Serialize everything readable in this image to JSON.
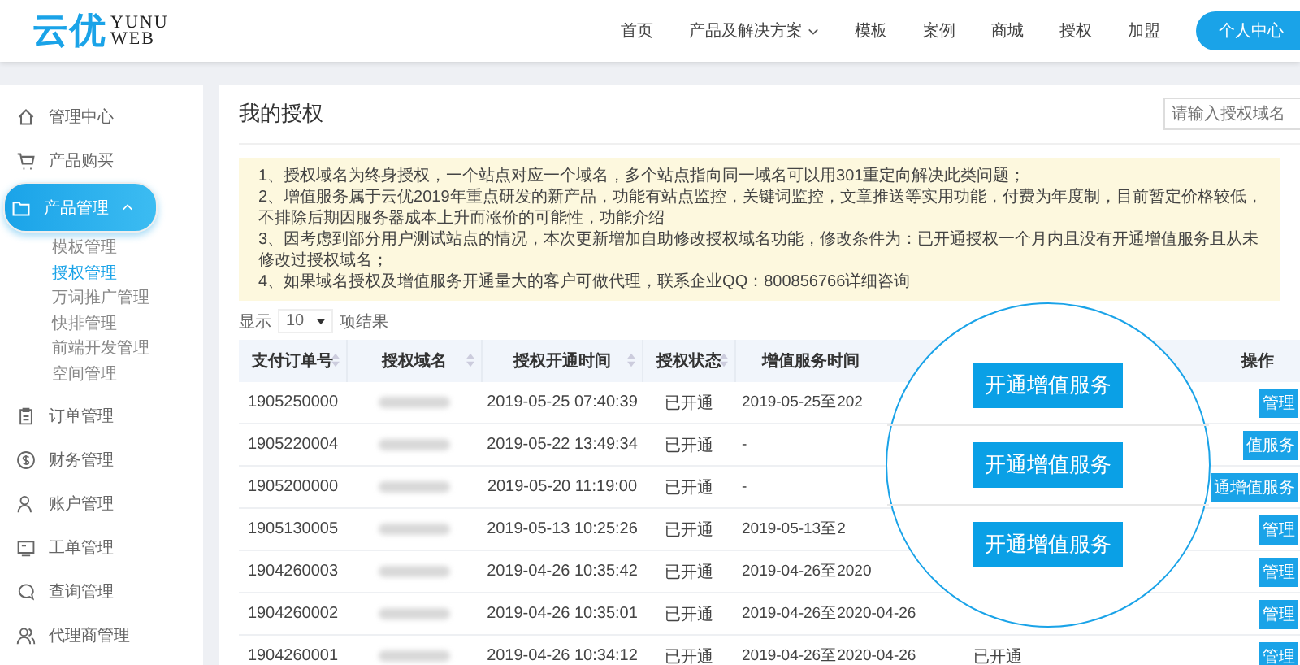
{
  "header": {
    "logo": {
      "main": "云优",
      "top": "YUNU",
      "bottom": "WEB"
    },
    "nav": [
      {
        "label": "首页",
        "dropdown": false
      },
      {
        "label": "产品及解决方案",
        "dropdown": true
      },
      {
        "label": "模板",
        "dropdown": false
      },
      {
        "label": "案例",
        "dropdown": false
      },
      {
        "label": "商城",
        "dropdown": false
      },
      {
        "label": "授权",
        "dropdown": false
      },
      {
        "label": "加盟",
        "dropdown": false
      }
    ],
    "user_button": "个人中心"
  },
  "sidebar": {
    "items": [
      {
        "kind": "home",
        "label": "管理中心",
        "selected": false
      },
      {
        "kind": "cart",
        "label": "产品购买",
        "selected": false
      },
      {
        "kind": "folder",
        "label": "产品管理",
        "selected": true,
        "expanded": true,
        "children": [
          {
            "label": "模板管理",
            "selected": false
          },
          {
            "label": "授权管理",
            "selected": true
          },
          {
            "label": "万词推广管理",
            "selected": false
          },
          {
            "label": "快排管理",
            "selected": false
          },
          {
            "label": "前端开发管理",
            "selected": false
          },
          {
            "label": "空间管理",
            "selected": false
          }
        ]
      },
      {
        "kind": "clipboard",
        "label": "订单管理",
        "selected": false
      },
      {
        "kind": "dollar",
        "label": "财务管理",
        "selected": false
      },
      {
        "kind": "user",
        "label": "账户管理",
        "selected": false
      },
      {
        "kind": "monitor",
        "label": "工单管理",
        "selected": false
      },
      {
        "kind": "chat",
        "label": "查询管理",
        "selected": false
      },
      {
        "kind": "users",
        "label": "代理商管理",
        "selected": false
      }
    ]
  },
  "page": {
    "title": "我的授权",
    "search": {
      "placeholder": "请输入授权域名"
    },
    "notices": [
      "1、授权域名为终身授权，一个站点对应一个域名，多个站点指向同一域名可以用301重定向解决此类问题；",
      "2、增值服务属于云优2019年重点研发的新产品，功能有站点监控，关键词监控，文章推送等实用功能，付费为年度制，目前暂定价格较低，不排除后期因服务器成本上升而涨价的可能性，功能介绍",
      "3、因考虑到部分用户测试站点的情况，本次更新增加自助修改授权域名功能，修改条件为：已开通授权一个月内且没有开通增值服务且从未修改过授权域名；",
      "4、如果域名授权及增值服务开通量大的客户可做代理，联系企业QQ：800856766详细咨询"
    ],
    "length": {
      "prefix": "显示",
      "value": "10",
      "suffix": "项结果"
    }
  },
  "table": {
    "columns": [
      {
        "label": "支付订单号",
        "sortable": true
      },
      {
        "label": "授权域名",
        "sortable": true
      },
      {
        "label": "授权开通时间",
        "sortable": true
      },
      {
        "label": "授权状态",
        "sortable": true
      },
      {
        "label": "增值服务时间"
      },
      {
        "label": "操作",
        "sortable": false
      }
    ],
    "rows": [
      {
        "order": "1905250000",
        "opened": "2019-05-25 07:40:39",
        "status": "已开通",
        "service": "2019-05-25至202",
        "action": "管理"
      },
      {
        "order": "1905220004",
        "opened": "2019-05-22 13:49:34",
        "status": "已开通",
        "service": "-",
        "action": "值服务"
      },
      {
        "order": "1905200000",
        "opened": "2019-05-20 11:19:00",
        "status": "已开通",
        "service": "-",
        "action": "通增值服务"
      },
      {
        "order": "1905130005",
        "opened": "2019-05-13 10:25:26",
        "status": "已开通",
        "service": "2019-05-13至2",
        "action": "管理"
      },
      {
        "order": "1904260003",
        "opened": "2019-04-26 10:35:42",
        "status": "已开通",
        "service": "2019-04-26至2020",
        "action": "管理"
      },
      {
        "order": "1904260002",
        "opened": "2019-04-26 10:35:01",
        "status": "已开通",
        "service": "2019-04-26至2020-04-26",
        "action": "管理"
      },
      {
        "order": "1904260001",
        "opened": "2019-04-26 10:34:12",
        "status": "已开通",
        "service": "2019-04-26至2020-04-26",
        "col6": "已开通",
        "action": "管理"
      }
    ]
  },
  "magnifier": {
    "buttons": [
      "开通增值服务",
      "开通增值服务",
      "开通增值服务"
    ]
  }
}
